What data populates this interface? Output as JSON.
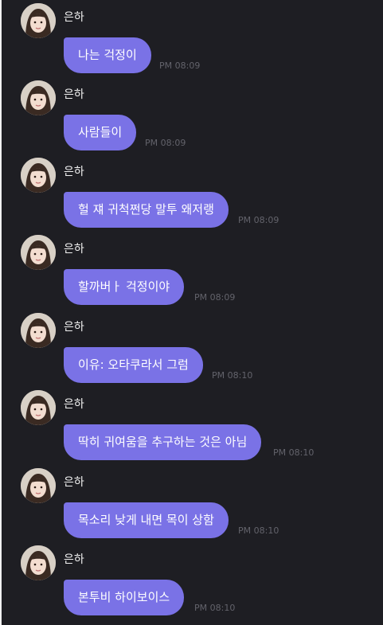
{
  "chat": {
    "messages": [
      {
        "sender": "은하",
        "text": "나는 걱정이",
        "time": "PM 08:09"
      },
      {
        "sender": "은하",
        "text": "사람들이",
        "time": "PM 08:09"
      },
      {
        "sender": "은하",
        "text": "헐 쟤 귀척쩐당 말투 왜저랭",
        "time": "PM 08:09"
      },
      {
        "sender": "은하",
        "text": "할까버ㅏ 걱정이야",
        "time": "PM 08:09"
      },
      {
        "sender": "은하",
        "text": "이유: 오타쿠라서 그럼",
        "time": "PM 08:10"
      },
      {
        "sender": "은하",
        "text": "딱히 귀여움을 추구하는 것은 아님",
        "time": "PM 08:10"
      },
      {
        "sender": "은하",
        "text": "목소리 낮게 내면 목이 상함",
        "time": "PM 08:10"
      },
      {
        "sender": "은하",
        "text": "본투비 하이보이스",
        "time": "PM 08:10"
      }
    ]
  },
  "colors": {
    "background": "#1e1e23",
    "bubble": "#7a72e6",
    "timestamp": "#63636b"
  },
  "icons": {
    "avatar": "profile-photo-avatar"
  }
}
